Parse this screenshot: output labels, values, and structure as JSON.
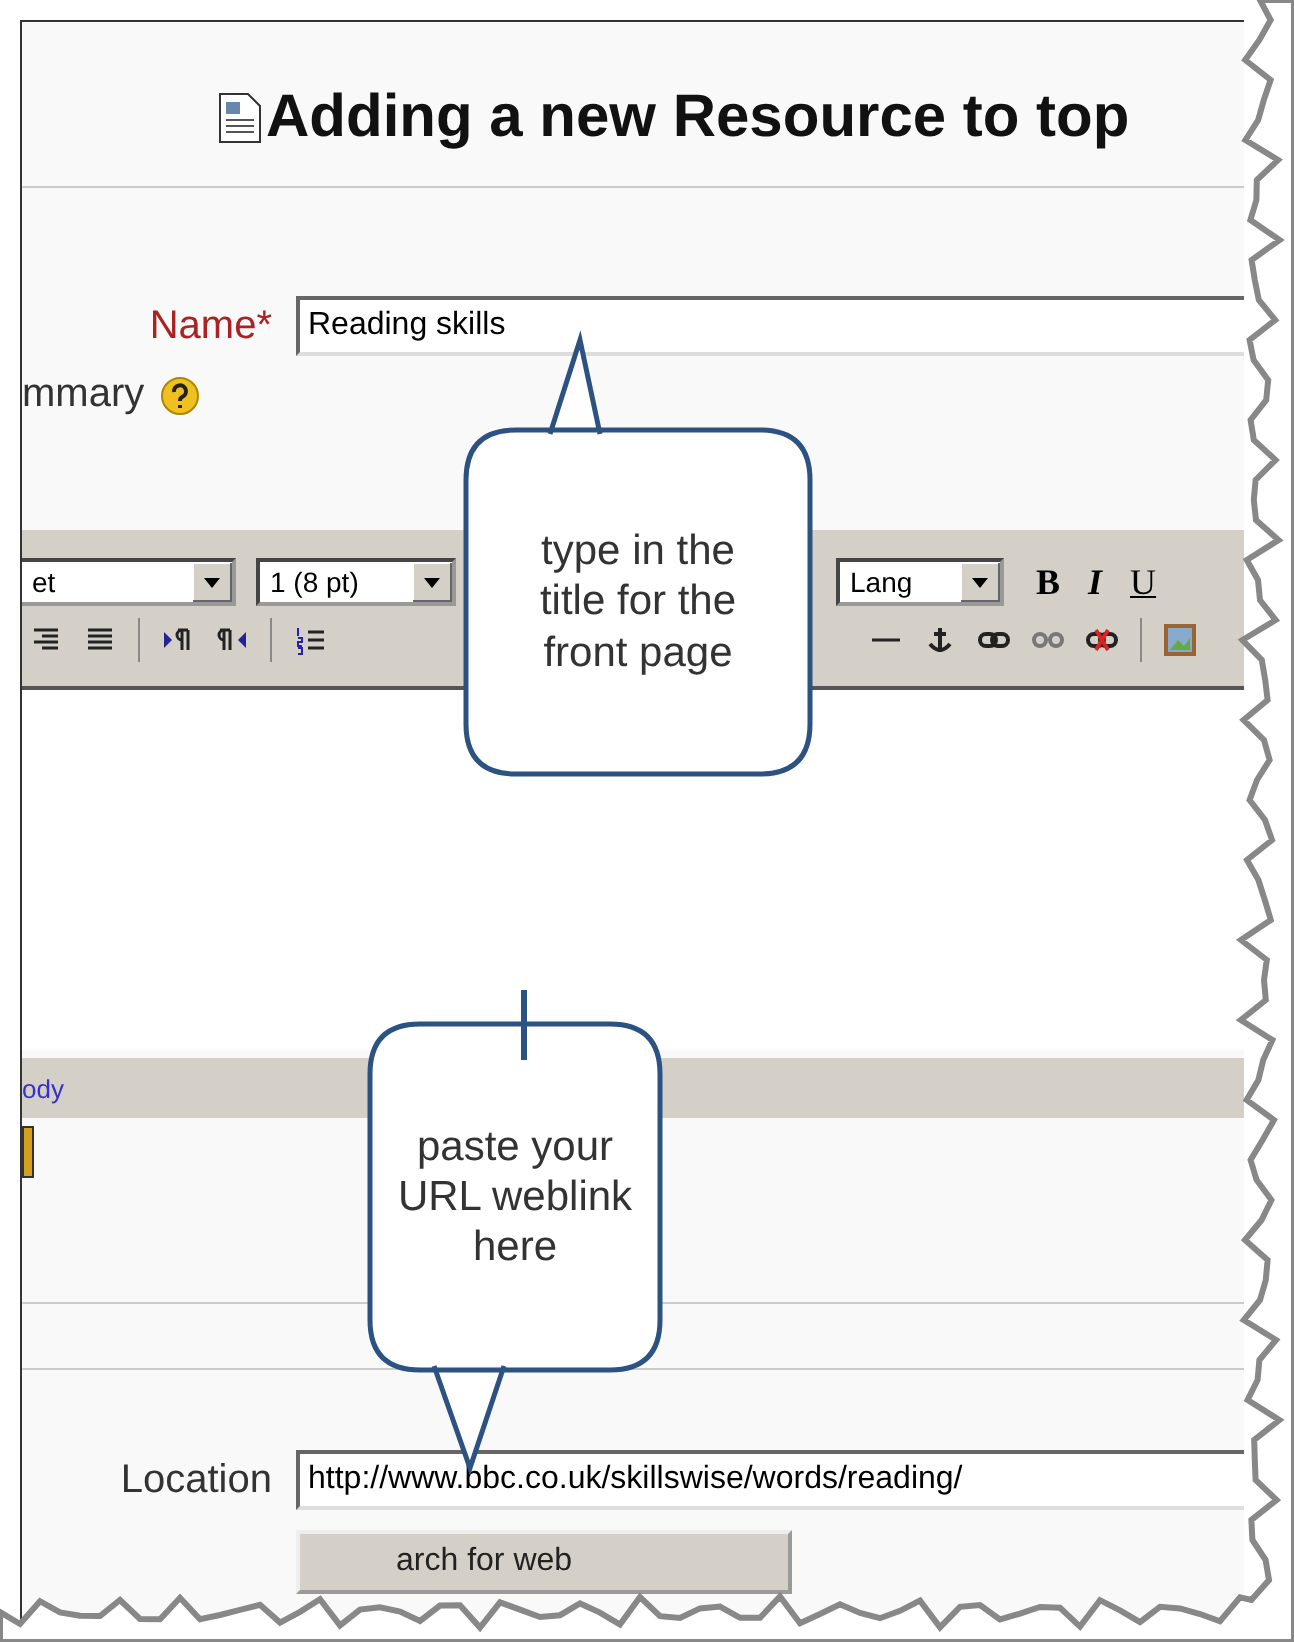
{
  "page": {
    "title": "Adding a new Resource to top"
  },
  "name_field": {
    "label": "Name",
    "required_mark": "*",
    "value": "Reading skills"
  },
  "summary": {
    "label": "mmary"
  },
  "editor": {
    "font": "et",
    "size": "1 (8 pt)",
    "lang": "Lang",
    "format_buttons": [
      "B",
      "I",
      "U"
    ],
    "path": "ody"
  },
  "location_field": {
    "label": "Location",
    "value": "http://www.bbc.co.uk/skillswise/words/reading/"
  },
  "search_button": {
    "label": "arch for web"
  },
  "callouts": [
    {
      "kind": "tail-up",
      "text": "type in the title for the front page"
    },
    {
      "kind": "tail-down",
      "text": "paste your URL weblink here"
    }
  ]
}
